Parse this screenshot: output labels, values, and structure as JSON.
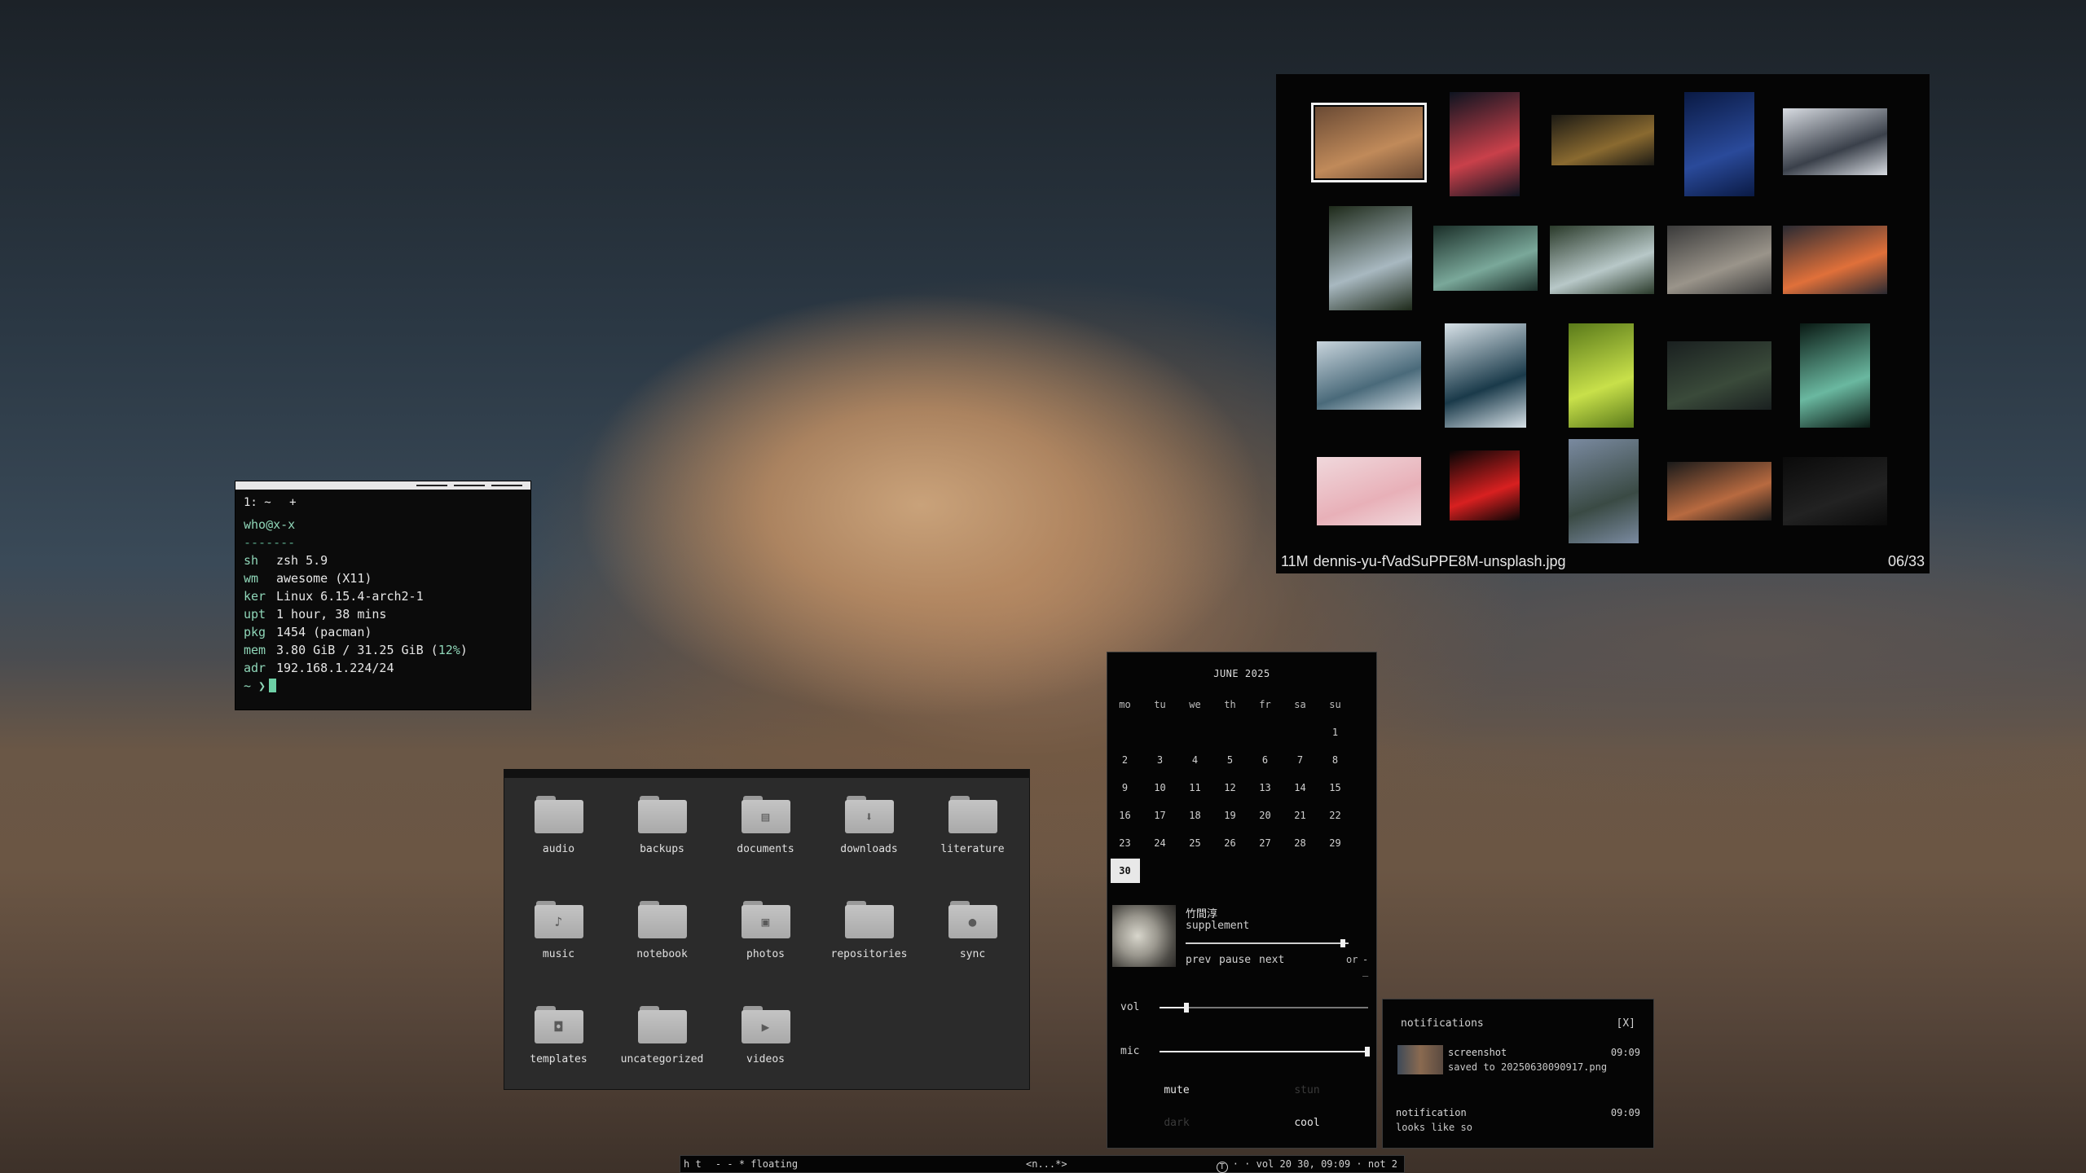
{
  "terminal": {
    "tab_label": "1: ~",
    "tab_add": "+",
    "userhost": "who@x-x",
    "separator": "-------",
    "info": [
      {
        "key": "sh",
        "value": "zsh 5.9"
      },
      {
        "key": "wm",
        "value": "awesome (X11)"
      },
      {
        "key": "ker",
        "value": "Linux 6.15.4-arch2-1"
      },
      {
        "key": "upt",
        "value": "1 hour, 38 mins"
      },
      {
        "key": "pkg",
        "value": "1454 (pacman)"
      },
      {
        "key": "mem",
        "value": "3.80 GiB / 31.25 GiB (",
        "suffix": "12%",
        "close": ")"
      },
      {
        "key": "adr",
        "value": "192.168.1.224/24"
      }
    ],
    "prompt": "~ ❯"
  },
  "filemanager": {
    "folders": [
      {
        "label": "audio",
        "icon": "folder-icon",
        "glyph": ""
      },
      {
        "label": "backups",
        "icon": "folder-icon",
        "glyph": ""
      },
      {
        "label": "documents",
        "icon": "document-icon",
        "glyph": "▤"
      },
      {
        "label": "downloads",
        "icon": "download-icon",
        "glyph": "⬇"
      },
      {
        "label": "literature",
        "icon": "folder-icon",
        "glyph": ""
      },
      {
        "label": "music",
        "icon": "music-note-icon",
        "glyph": "♪"
      },
      {
        "label": "notebook",
        "icon": "folder-icon",
        "glyph": ""
      },
      {
        "label": "photos",
        "icon": "image-icon",
        "glyph": "▣"
      },
      {
        "label": "repositories",
        "icon": "folder-icon",
        "glyph": ""
      },
      {
        "label": "sync",
        "icon": "user-icon",
        "glyph": "●"
      },
      {
        "label": "templates",
        "icon": "template-icon",
        "glyph": "◘"
      },
      {
        "label": "uncategorized",
        "icon": "folder-icon",
        "glyph": ""
      },
      {
        "label": "videos",
        "icon": "play-icon",
        "glyph": "▶"
      }
    ]
  },
  "viewer": {
    "size": "11M",
    "filename": "dennis-yu-fVadSuPPE8M-unsplash.jpg",
    "position": "06/33",
    "thumbnails": [
      {
        "c1": "#6a4a34",
        "c2": "#c08a5a"
      },
      {
        "c1": "#0e1420",
        "c2": "#c9404a"
      },
      {
        "c1": "#1c1a14",
        "c2": "#8a6a30"
      },
      {
        "c1": "#0a1a44",
        "c2": "#2a4a9a"
      },
      {
        "c1": "#d8dce2",
        "c2": "#3a404a"
      },
      {
        "c1": "#1e2a1a",
        "c2": "#a8b8c0"
      },
      {
        "c1": "#1a2e28",
        "c2": "#7aa89a"
      },
      {
        "c1": "#2a3a2a",
        "c2": "#b8c8c8"
      },
      {
        "c1": "#3a3a3a",
        "c2": "#9a948a"
      },
      {
        "c1": "#2a2a32",
        "c2": "#e0703a"
      },
      {
        "c1": "#c8d4dc",
        "c2": "#4a6a7a"
      },
      {
        "c1": "#d8e2e8",
        "c2": "#1a3a4a"
      },
      {
        "c1": "#5a7a1a",
        "c2": "#c8e04a"
      },
      {
        "c1": "#1a2020",
        "c2": "#3a4a3a"
      },
      {
        "c1": "#0a1a14",
        "c2": "#6ab8a0"
      },
      {
        "c1": "#f0d8dc",
        "c2": "#e8b0b8"
      },
      {
        "c1": "#050505",
        "c2": "#d82020"
      },
      {
        "c1": "#7a8aa0",
        "c2": "#3a4a44"
      },
      {
        "c1": "#1a1a1a",
        "c2": "#b86a40"
      },
      {
        "c1": "#0a0a0a",
        "c2": "#222222"
      }
    ]
  },
  "calendar": {
    "title": "JUNE 2025",
    "weekdays": [
      "mo",
      "tu",
      "we",
      "th",
      "fr",
      "sa",
      "su"
    ],
    "first_weekday_index": 6,
    "days_in_month": 30,
    "today": 30
  },
  "music": {
    "artist": "竹間淳",
    "track": "supplement",
    "progress": 0.96,
    "prev": "prev",
    "pause": "pause",
    "next": "next",
    "or": "or",
    "more": "-_"
  },
  "sliders": {
    "vol": {
      "label": "vol",
      "value": 0.13
    },
    "mic": {
      "label": "mic",
      "value": 1.0
    }
  },
  "toggles": {
    "mute": "mute",
    "stun": "stun",
    "dark": "dark",
    "cool": "cool"
  },
  "notifications": {
    "title": "notifications",
    "close": "[X]",
    "items": [
      {
        "title": "screenshot",
        "body": "saved to 20250630090917.png",
        "time": "09:09"
      },
      {
        "title": "notification",
        "body": "looks like so",
        "time": "09:09"
      }
    ]
  },
  "statusbar": {
    "tags": "h t",
    "layout": "- - * floating",
    "window": "<n...*>",
    "right": "· · vol 20  30, 09:09 · not 2"
  },
  "colors": {
    "accent": "#8fd6b8",
    "cursor": "#6ed0a6",
    "panel_bg": "#050505",
    "filemgr_bg": "#2b2b2b"
  }
}
